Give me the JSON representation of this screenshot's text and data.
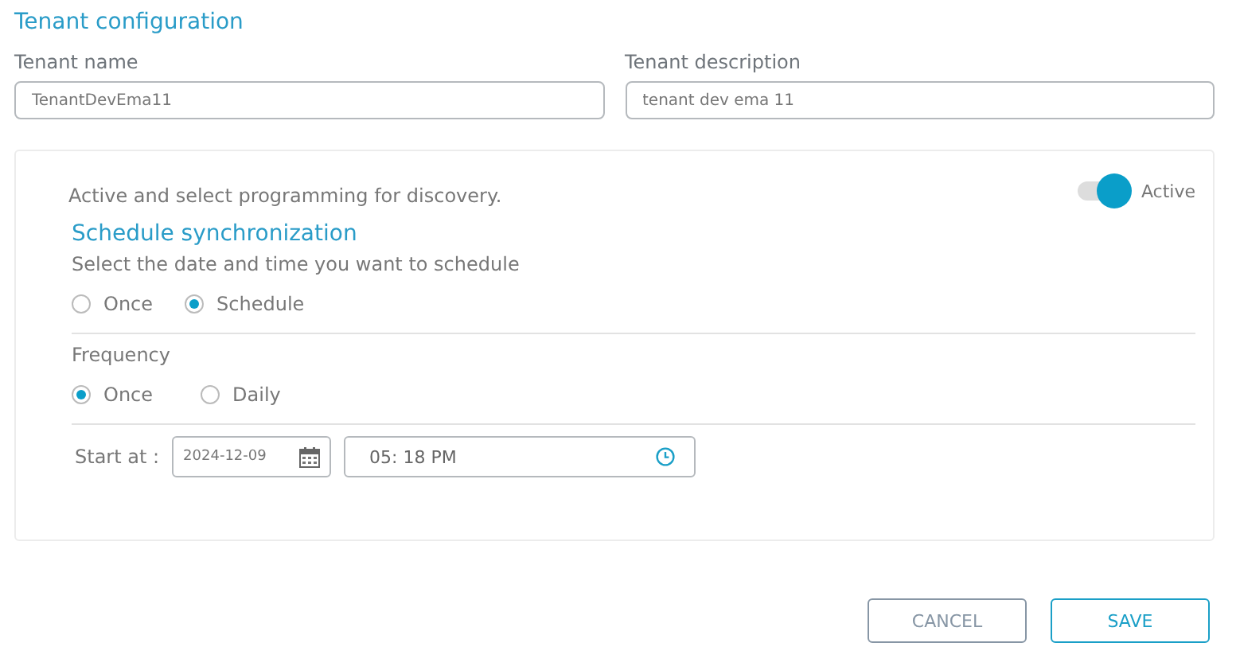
{
  "title": "Tenant configuration",
  "fields": [
    {
      "label": "Tenant name",
      "value": "TenantDevEma11"
    },
    {
      "label": "Tenant description",
      "value": "tenant dev ema 11"
    }
  ],
  "panel": {
    "description": "Active and select programming for discovery.",
    "toggle": {
      "label": "Active",
      "on": true
    },
    "heading": "Schedule synchronization",
    "hint": "Select the date and time you want to schedule",
    "mode_options": [
      {
        "label": "Once",
        "selected": false
      },
      {
        "label": "Schedule",
        "selected": true
      }
    ],
    "frequency_label": "Frequency",
    "frequency_options": [
      {
        "label": "Once",
        "selected": true
      },
      {
        "label": "Daily",
        "selected": false
      }
    ],
    "start_label": "Start at :",
    "date": "2024-12-09",
    "time": "05: 18 PM"
  },
  "buttons": [
    {
      "label": "CANCEL",
      "kind": "secondary"
    },
    {
      "label": "SAVE",
      "kind": "primary"
    }
  ]
}
